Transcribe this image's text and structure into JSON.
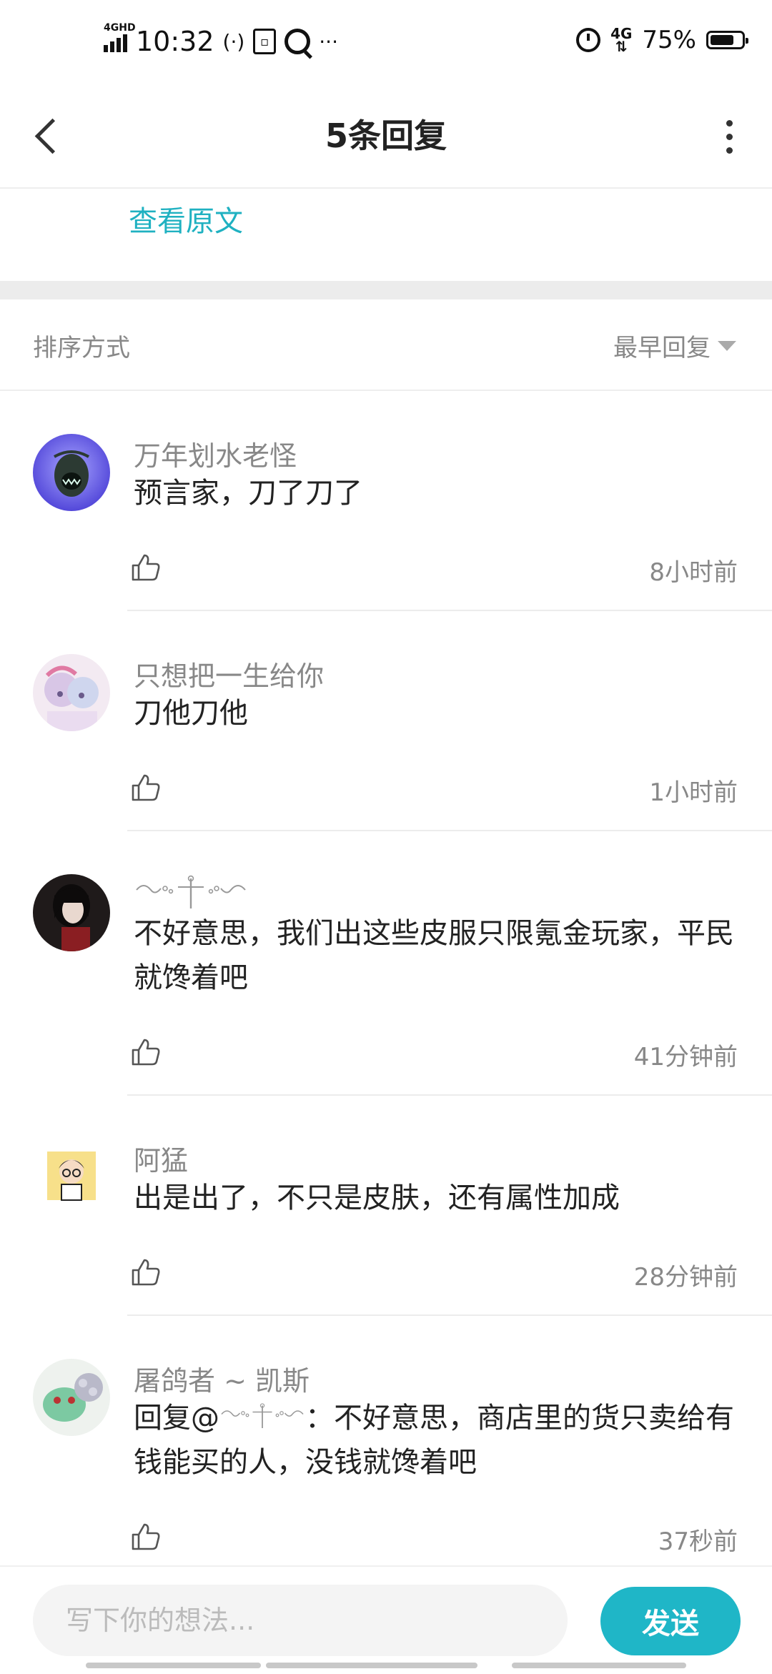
{
  "status_bar": {
    "network_tag": "4GHD",
    "time": "10:32",
    "right_network": "4G",
    "battery": "75%",
    "battery_level": 0.75
  },
  "header": {
    "title": "5条回复"
  },
  "original_link": "查看原文",
  "sort": {
    "label": "排序方式",
    "value": "最早回复"
  },
  "comments": [
    {
      "author": "万年划水老怪",
      "text": "预言家，刀了刀了",
      "time": "8小时前"
    },
    {
      "author": "只想把一生给你",
      "text": "刀他刀他",
      "time": "1小时前"
    },
    {
      "author": "",
      "text": "不好意思，我们出这些皮服只限氪金玩家，平民就馋着吧",
      "time": "41分钟前"
    },
    {
      "author": "阿猛",
      "text": "出是出了，不只是皮肤，还有属性加成",
      "time": "28分钟前"
    },
    {
      "author": "屠鸽者 ~ 凯斯",
      "text_prefix": "回复@",
      "text_suffix": "：不好意思，商店里的货只卖给有钱能买的人，没钱就馋着吧",
      "time": "37秒前"
    }
  ],
  "input": {
    "placeholder": "写下你的想法..."
  },
  "send_label": "发送",
  "colors": {
    "accent": "#1fb6c7",
    "link": "#1fb1c1",
    "muted_text": "#888888",
    "divider": "#ececec"
  }
}
